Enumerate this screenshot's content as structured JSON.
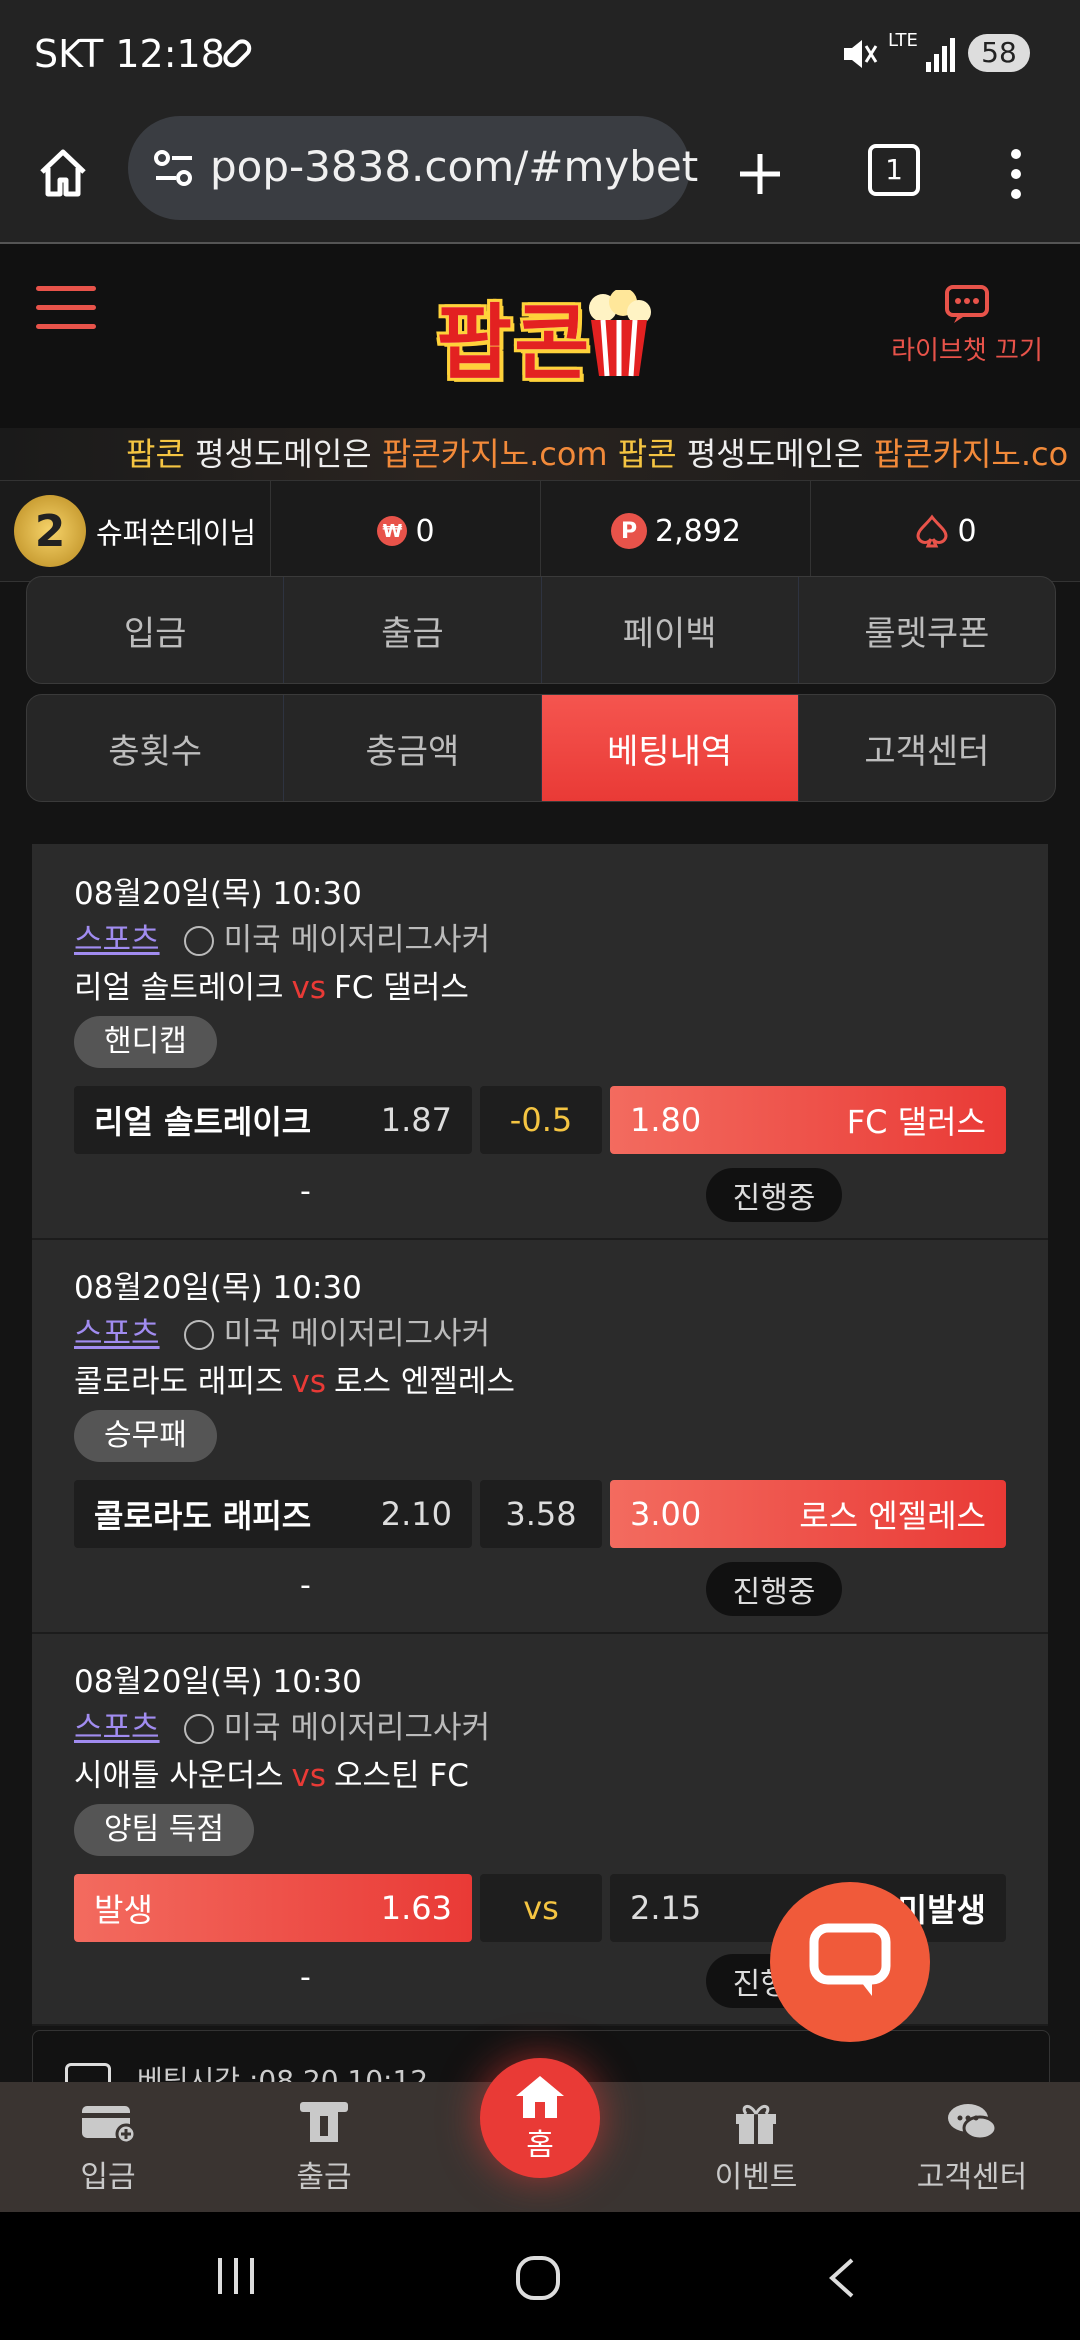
{
  "statusbar": {
    "carrier_time": "SKT 12:18",
    "network": "LTE",
    "battery": "58"
  },
  "browser": {
    "url": "pop-3838.com/#mybet",
    "tab_count": "1"
  },
  "header": {
    "logo_text": "팝콘",
    "livechat_label": "라이브챗 끄기"
  },
  "marquee": {
    "parts": [
      "팝콘",
      " 평생도메인은 ",
      "팝콘카지노.com",
      " 팝콘",
      " 평생도메인은 ",
      "팝콘카지노.co"
    ]
  },
  "user": {
    "level": "2",
    "nickname": "슈퍼쏜데이님",
    "won_symbol": "₩",
    "cash": "0",
    "point_symbol": "P",
    "points": "2,892",
    "casino": "0"
  },
  "menu_row1": [
    "입금",
    "출금",
    "페이백",
    "룰렛쿠폰"
  ],
  "menu_row2": [
    "충횟수",
    "충금액",
    "베팅내역",
    "고객센터"
  ],
  "bets": [
    {
      "date": "08월20일(목) 10:30",
      "category": "스포츠",
      "league": "미국 메이저리그사커",
      "home": "리얼 솔트레이크",
      "vs": "vs",
      "away": "FC 댈러스",
      "market": "핸디캡",
      "o1_label": "리얼 솔트레이크",
      "o1_odd": "1.87",
      "o2": "-0.5",
      "o3_odd": "1.80",
      "o3_label": "FC 댈러스",
      "result": "-",
      "status": "진행중"
    },
    {
      "date": "08월20일(목) 10:30",
      "category": "스포츠",
      "league": "미국 메이저리그사커",
      "home": "콜로라도 래피즈",
      "vs": "vs",
      "away": "로스 엔젤레스",
      "market": "승무패",
      "o1_label": "콜로라도 래피즈",
      "o1_odd": "2.10",
      "o2": "3.58",
      "o3_odd": "3.00",
      "o3_label": "로스 엔젤레스",
      "result": "-",
      "status": "진행중"
    },
    {
      "date": "08월20일(목) 10:30",
      "category": "스포츠",
      "league": "미국 메이저리그사커",
      "home": "시애틀 사운더스",
      "vs": "vs",
      "away": "오스틴 FC",
      "market": "양팀 득점",
      "o1_label": "발생",
      "o1_odd": "1.63",
      "o2": "vs",
      "o3_odd": "2.15",
      "o3_label": "미발생",
      "result": "-",
      "status": "진행중"
    }
  ],
  "next_card_peek": "베팅시간 :08.20 10:12",
  "bottomnav": {
    "deposit": "입금",
    "withdraw": "출금",
    "home": "홈",
    "event": "이벤트",
    "support": "고객센터"
  }
}
